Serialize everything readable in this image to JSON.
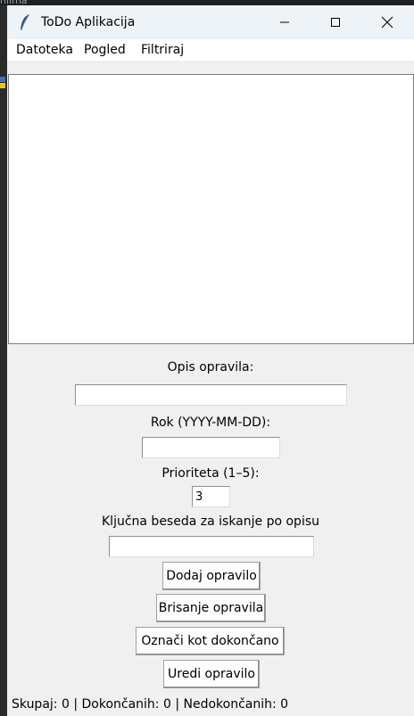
{
  "window": {
    "title": "ToDo Aplikacija"
  },
  "menu": {
    "items": [
      "Datoteka",
      "Pogled",
      "Filtriraj"
    ]
  },
  "form": {
    "description_label": "Opis opravila:",
    "description_value": "",
    "deadline_label": "Rok (YYYY-MM-DD):",
    "deadline_value": "",
    "priority_label": "Prioriteta (1–5):",
    "priority_value": "3",
    "keyword_label": "Ključna beseda za iskanje po opisu",
    "keyword_value": ""
  },
  "buttons": {
    "add": "Dodaj opravilo",
    "delete": "Brisanje opravila",
    "mark_done": "Označi kot dokončano",
    "edit": "Uredi opravilo"
  },
  "status": {
    "text": "Skupaj: 0 | Dokončanih: 0 | Nedokončanih: 0"
  },
  "colors": {
    "window_bg": "#f0f0f0",
    "titlebar_bg": "#eef3f8",
    "list_bg": "#ffffff"
  }
}
